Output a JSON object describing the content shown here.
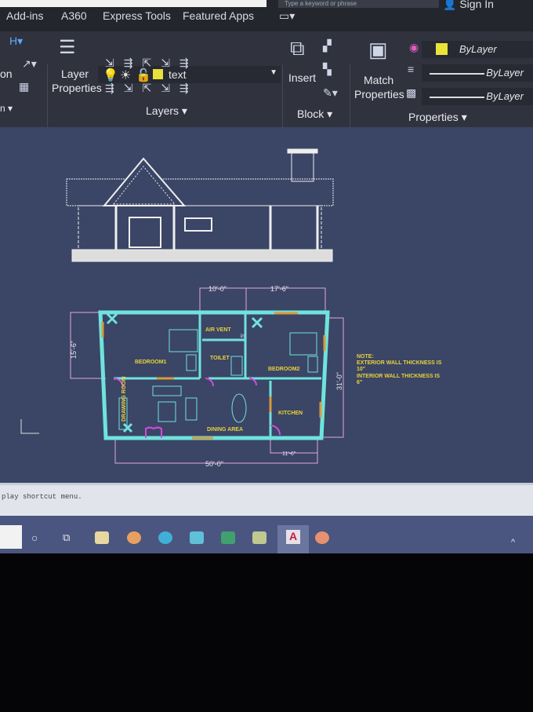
{
  "tabs": [
    "Add-ins",
    "A360",
    "Express Tools",
    "Featured Apps"
  ],
  "search_placeholder": "Type a keyword or phrase",
  "signin": "Sign In",
  "ribbon": {
    "left_panel_label": "on",
    "left_panel_footer": "n",
    "layer_properties": [
      "Layer",
      "Properties"
    ],
    "layer_current": "text",
    "layers_footer": "Layers",
    "insert": "Insert",
    "block_footer": "Block",
    "match_properties": [
      "Match",
      "Properties"
    ],
    "color": "ByLayer",
    "linetype": "ByLayer",
    "lineweight": "ByLayer",
    "properties_footer": "Properties"
  },
  "drawing": {
    "dims": {
      "top1": "10'-0\"",
      "top2": "17'-6\"",
      "left": "15'-6\"",
      "right": "31'-0\"",
      "bottom": "50'-0\"",
      "kitchen": "11'-6\"",
      "vent": "5'"
    },
    "rooms": {
      "bedroom1": "BEDROOM1",
      "bedroom2": "BEDROOM2",
      "air_vent": "AIR VENT",
      "toilet": "TOILET",
      "drawing_room": "DRAWING ROOM",
      "dining": "DINING AREA",
      "kitchen": "KITCHEN"
    },
    "note": [
      "NOTE:",
      "EXTERIOR WALL THICKNESS IS",
      "10\"",
      "INTERIOR WALL THICKNESS IS",
      "6\""
    ]
  },
  "command_line": "play shortcut menu.",
  "taskbar": [
    "cortana",
    "task-view",
    "store",
    "chrome",
    "edge",
    "mail",
    "excel",
    "photos",
    "autocad",
    "chrome-2"
  ],
  "colors": {
    "wall": "#6fe3dc",
    "dim": "#e2a6e0",
    "text": "#e8d23a",
    "door": "#d04cd8",
    "window": "#d89a3a",
    "canvas": "#3b4566"
  }
}
